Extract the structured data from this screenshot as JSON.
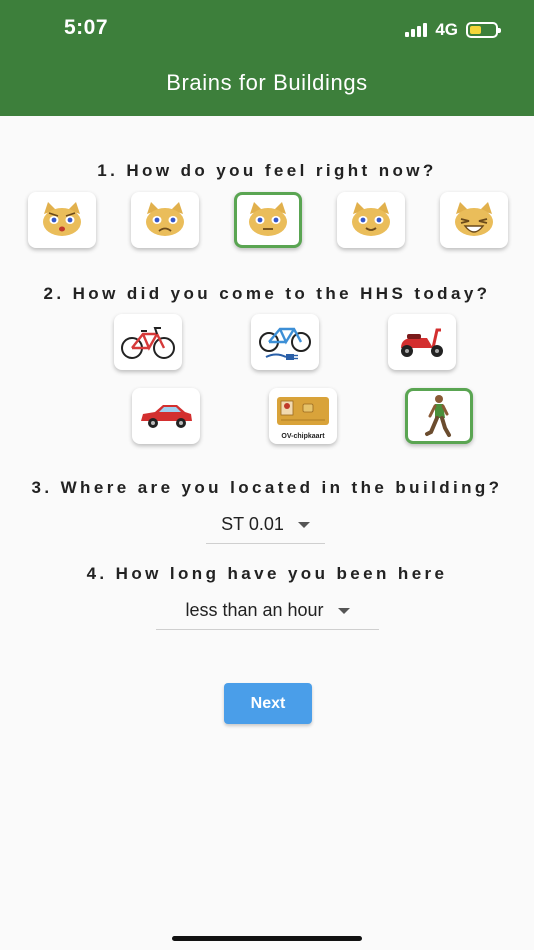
{
  "status_bar": {
    "time": "5:07",
    "network": "4G"
  },
  "app_bar": {
    "title": "Brains for Buildings"
  },
  "questions": {
    "q1": "1. How do you feel right now?",
    "q2": "2. How did you come to the HHS today?",
    "q3": "3. Where are you located in the building?",
    "q4": "4. How long have you been here"
  },
  "moods": [
    {
      "icon": "angry-cat-icon",
      "selected": false
    },
    {
      "icon": "sad-cat-icon",
      "selected": false
    },
    {
      "icon": "neutral-cat-icon",
      "selected": true
    },
    {
      "icon": "content-cat-icon",
      "selected": false
    },
    {
      "icon": "laughing-cat-icon",
      "selected": false
    }
  ],
  "transport": [
    {
      "icon": "bicycle-icon",
      "selected": false
    },
    {
      "icon": "electric-bicycle-icon",
      "selected": false
    },
    {
      "icon": "scooter-icon",
      "selected": false
    },
    {
      "icon": "car-icon",
      "selected": false
    },
    {
      "icon": "ov-chipkaart-icon",
      "label": "OV-chipkaart",
      "selected": false
    },
    {
      "icon": "walking-person-icon",
      "selected": true
    }
  ],
  "location_dropdown": {
    "value": "ST 0.01"
  },
  "duration_dropdown": {
    "value": "less than an hour"
  },
  "next_button": {
    "label": "Next"
  },
  "colors": {
    "app_bar": "#3d7f3b",
    "selected_border": "#5aa552",
    "button": "#4a9ee9"
  }
}
